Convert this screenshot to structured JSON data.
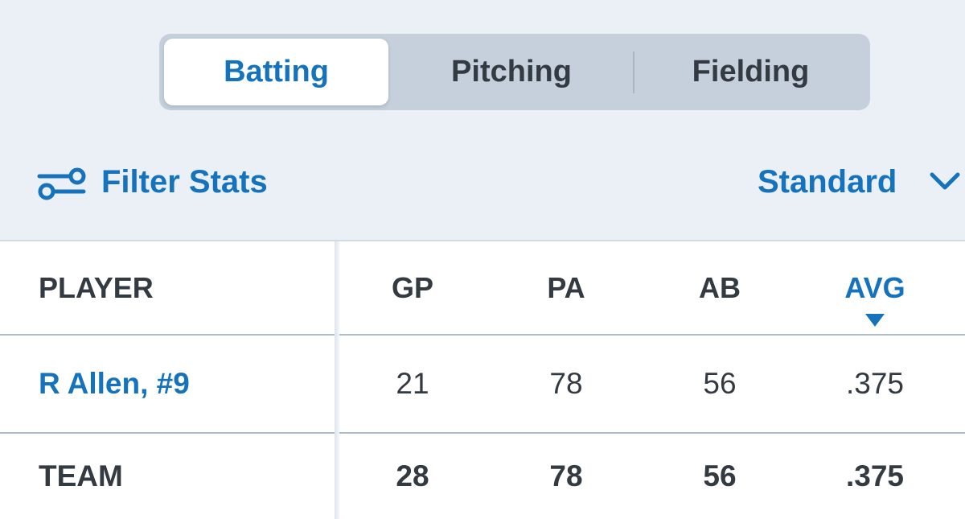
{
  "tabs": [
    {
      "label": "Batting",
      "active": true
    },
    {
      "label": "Pitching",
      "active": false
    },
    {
      "label": "Fielding",
      "active": false
    }
  ],
  "filter": {
    "label": "Filter Stats",
    "icon": "filter-sliders-icon"
  },
  "view_select": {
    "selected": "Standard",
    "icon": "chevron-down-icon"
  },
  "table": {
    "headers": {
      "player": "PLAYER",
      "gp": "GP",
      "pa": "PA",
      "ab": "AB",
      "avg": "AVG"
    },
    "sorted_column": "AVG",
    "sort_direction": "descending",
    "rows": [
      {
        "player": "R Allen, #9",
        "gp": "21",
        "pa": "78",
        "ab": "56",
        "avg": ".375"
      }
    ],
    "team": {
      "player": "TEAM",
      "gp": "28",
      "pa": "78",
      "ab": "56",
      "avg": ".375"
    }
  },
  "colors": {
    "accent": "#1573be",
    "text": "#333a42",
    "header_bg": "#ebf0f7",
    "segment_bg": "#c5d0dc"
  }
}
